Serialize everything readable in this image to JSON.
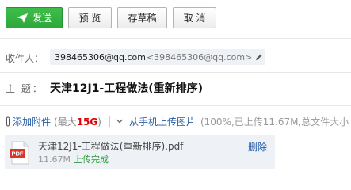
{
  "toolbar": {
    "send_label": "发送",
    "preview_label": "预 览",
    "save_draft_label": "存草稿",
    "cancel_label": "取 消"
  },
  "recipient": {
    "label": "收件人：",
    "name": "398465306@qq.com",
    "address": "<398465306@qq.com>"
  },
  "subject": {
    "label": "主  题：",
    "value": "天津12J1-工程做法(重新排序)"
  },
  "attachments": {
    "add_label": "添加附件",
    "max_prefix": "(最大",
    "max_size": "15G",
    "max_suffix": ")",
    "mobile_upload_label": "从手机上传图片",
    "progress_info": "(100%,已上传11.67M,总文件大小"
  },
  "file": {
    "name": "天津12J1-工程做法(重新排序).pdf",
    "size": "11.67M",
    "status": "上传完成",
    "delete_label": "删除",
    "type_icon_text": "PDF"
  },
  "colors": {
    "send_green": "#35b243",
    "link_blue": "#245ba6",
    "pdf_red": "#d9372b",
    "max_red": "#dd0000"
  }
}
